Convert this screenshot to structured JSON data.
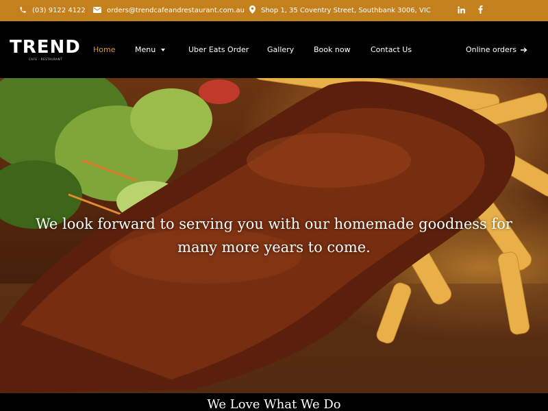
{
  "topbar": {
    "phone": "(03) 9122 4122",
    "email": "orders@trendcafeandrestaurant.com.au",
    "address": "Shop 1, 35 Coventry Street, Southbank 3006, VIC",
    "social": [
      "linkedin-icon",
      "facebook-icon"
    ]
  },
  "brand": {
    "name": "TREND",
    "tagline": "CAFE · RESTAURANT"
  },
  "nav": {
    "home": "Home",
    "menu": "Menu",
    "uber": "Uber Eats Order",
    "gallery": "Gallery",
    "book": "Book now",
    "contact": "Contact Us",
    "online": "Online orders"
  },
  "hero": {
    "line1": "We look forward to serving you with our homemade goodness for",
    "line2": "many more years to come."
  },
  "section": {
    "title": "We Love What We Do"
  },
  "colors": {
    "topbar": "#c4801d",
    "active": "#d59a3f",
    "nav_bg": "#000000"
  }
}
